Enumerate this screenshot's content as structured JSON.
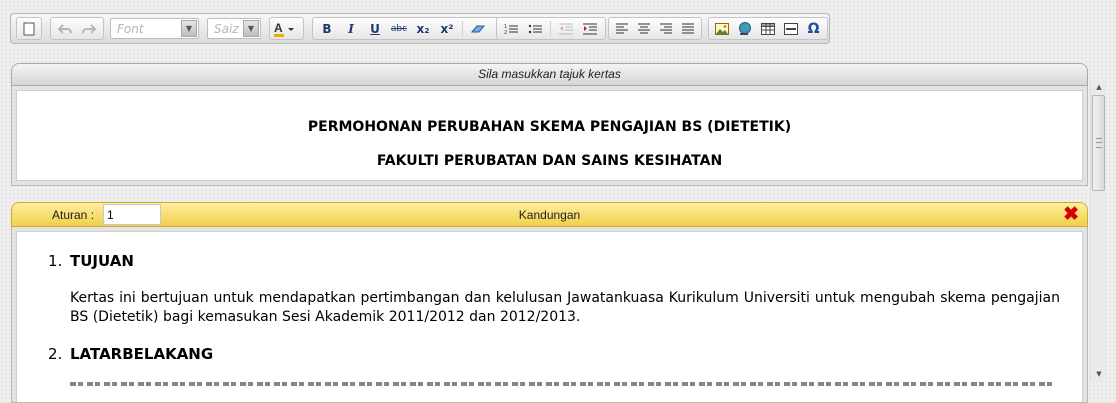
{
  "toolbar": {
    "font_combo": {
      "placeholder": "Font"
    },
    "size_combo": {
      "placeholder": "Saiz"
    },
    "buttons": {
      "bold": "B",
      "italic": "I",
      "underline": "U",
      "strikethrough": "abc",
      "subscript": "x₂",
      "superscript": "x²",
      "special_char": "Ω"
    },
    "icons": [
      "new-document-icon",
      "undo-icon",
      "redo-icon",
      "font-color-icon",
      "eraser-icon",
      "ordered-list-icon",
      "unordered-list-icon",
      "outdent-icon",
      "indent-icon",
      "align-left-icon",
      "align-center-icon",
      "align-right-icon",
      "align-justify-icon",
      "insert-image-icon",
      "insert-link-icon",
      "insert-table-icon",
      "horizontal-rule-icon",
      "omega-icon"
    ]
  },
  "title_section": {
    "header": "Sila masukkan tajuk kertas",
    "line1": "PERMOHONAN PERUBAHAN SKEMA PENGAJIAN BS (DIETETIK)",
    "line2": "FAKULTI PERUBATAN DAN SAINS KESIHATAN"
  },
  "content_section": {
    "aturan_label": "Aturan :",
    "aturan_value": "1",
    "header": "Kandungan",
    "close_icon": "close-x-icon",
    "close_color": "#d40000",
    "sections": [
      {
        "number": "1.",
        "heading": "TUJUAN",
        "text": "Kertas ini bertujuan untuk mendapatkan pertimbangan dan kelulusan Jawatankuasa Kurikulum Universiti  untuk mengubah skema pengajian BS (Dietetik) bagi kemasukan  Sesi Akademik 2011/2012 dan 2012/2013."
      },
      {
        "number": "2.",
        "heading": "LATARBELAKANG"
      }
    ]
  },
  "colors": {
    "content_bar": "#f1d04a",
    "title_bar": "#dcdcdc"
  }
}
